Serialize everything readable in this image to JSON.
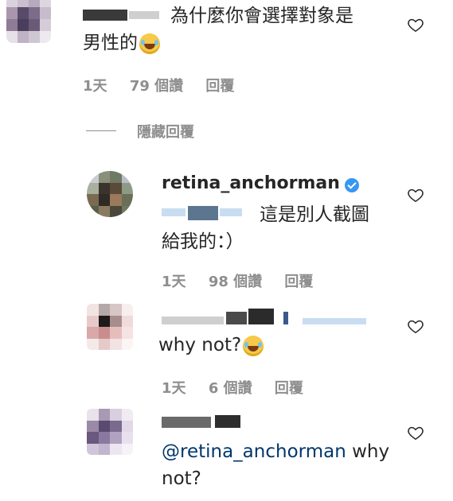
{
  "comments": [
    {
      "text": "為什麼你會選擇對象是",
      "text_line2": "男性的",
      "meta": {
        "time": "1天",
        "likes": "79 個讚",
        "reply": "回覆"
      }
    },
    {
      "username": "retina_anchorman",
      "text_line1": "這是別人截圖",
      "text_line2": "給我的：）",
      "meta": {
        "time": "1天",
        "likes": "98 個讚",
        "reply": "回覆"
      }
    },
    {
      "text": "why not?",
      "meta": {
        "time": "1天",
        "likes": "6 個讚",
        "reply": "回覆"
      }
    },
    {
      "mention": "@retina_anchorman",
      "text_line1": "why",
      "text_line2": "not?"
    }
  ],
  "hide_replies": "隱藏回覆",
  "colors": {
    "meta": "#8e8e8e",
    "mention": "#00376b",
    "verified": "#3897f0"
  },
  "icons": [
    "heart-icon",
    "verified-badge-icon",
    "laughing-emoji-icon"
  ]
}
